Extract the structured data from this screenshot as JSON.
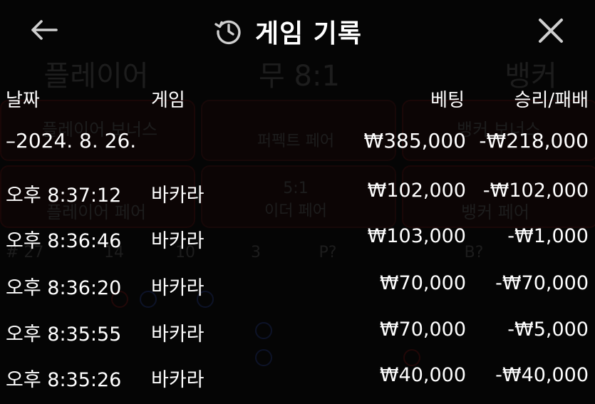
{
  "header": {
    "title": "게임 기록",
    "back_icon": "arrow-left-icon",
    "history_icon": "history-icon",
    "close_icon": "close-icon"
  },
  "columns": {
    "date": "날짜",
    "game": "게임",
    "bet": "베팅",
    "result": "승리/패배"
  },
  "date_group": {
    "date": "–2024. 8. 26.",
    "bet_total": "₩385,000",
    "result_total": "-₩218,000"
  },
  "rows": [
    {
      "time": "오후 8:37:12",
      "game": "바카라",
      "bet": "₩102,000",
      "result": "-₩102,000"
    },
    {
      "time": "오후 8:36:46",
      "game": "바카라",
      "bet": "₩103,000",
      "result": "-₩1,000"
    },
    {
      "time": "오후 8:36:20",
      "game": "바카라",
      "bet": "₩70,000",
      "result": "-₩70,000"
    },
    {
      "time": "오후 8:35:55",
      "game": "바카라",
      "bet": "₩70,000",
      "result": "-₩5,000"
    },
    {
      "time": "오후 8:35:26",
      "game": "바카라",
      "bet": "₩40,000",
      "result": "-₩40,000"
    }
  ],
  "background": {
    "player": "플레이어",
    "tie": "무 8:1",
    "banker": "뱅커",
    "player_bonus": "플레이어 보너스",
    "perfect_pair": "퍼펙트 페어",
    "banker_bonus": "뱅커 보너스",
    "player_pair": "플레이어 페어",
    "either_pair_ratio": "5:1",
    "either_pair": "이더 페어",
    "banker_pair": "뱅커 페어",
    "round_count": "# 27",
    "player_count": "14",
    "banker_count": "10",
    "tie_count": "3",
    "p_label": "P?",
    "b_label": "B?"
  },
  "colors": {
    "background": "#050505",
    "text": "#ffffff",
    "icon": "#cfcfcf"
  }
}
